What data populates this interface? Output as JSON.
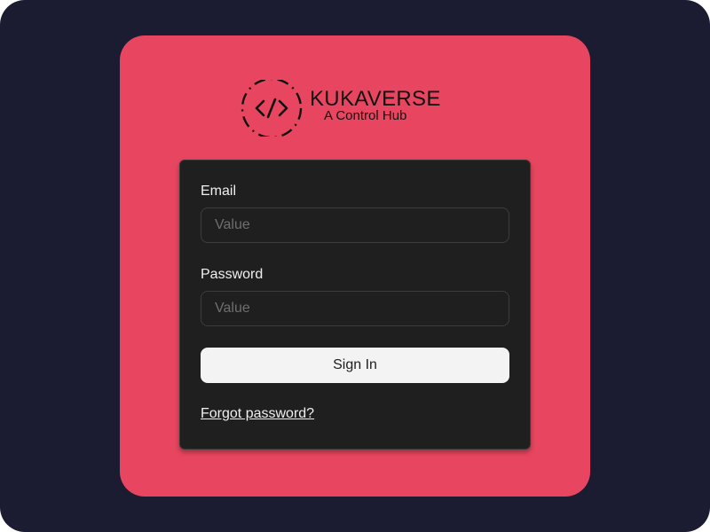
{
  "brand": {
    "logo_icon": "code-brackets-icon",
    "name": "KUKAVERSE",
    "tagline": "A Control Hub"
  },
  "login_form": {
    "email_label": "Email",
    "email_placeholder": "Value",
    "email_value": "",
    "password_label": "Password",
    "password_placeholder": "Value",
    "password_value": "",
    "signin_label": "Sign In",
    "forgot_label": "Forgot password?"
  },
  "colors": {
    "page_background": "#1b1c31",
    "card_background": "#e84660",
    "panel_background": "#1f1f1f",
    "button_background": "#f3f3f3"
  }
}
